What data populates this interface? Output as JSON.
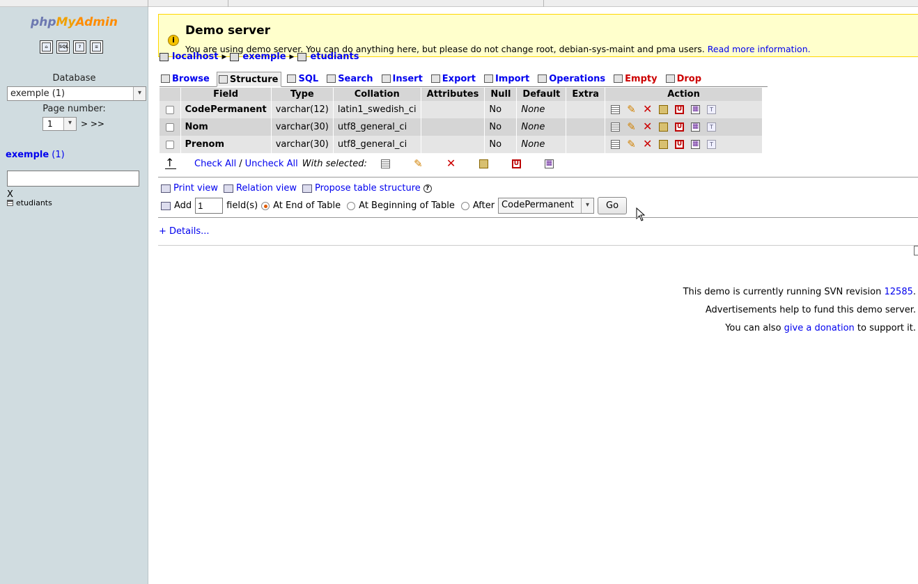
{
  "nav": {
    "logo": {
      "part1": "php",
      "part2": "My",
      "part3": "Admin"
    },
    "icons": [
      "home-icon",
      "sql-window-icon",
      "query-window-icon",
      "docs-icon"
    ],
    "database_label": "Database",
    "database_value": "exemple (1)",
    "page_number_label": "Page number:",
    "page_value": "1",
    "page_nav": "> >>",
    "db_link": "exemple",
    "db_count": "(1)",
    "filter_clear": "X",
    "tables": [
      "etudiants"
    ]
  },
  "notice": {
    "title": "Demo server",
    "text": "You are using demo server. You can do anything here, but please do not change root, debian-sys-maint and pma users.",
    "link": "Read more information."
  },
  "breadcrumb": {
    "server": "localhost",
    "database": "exemple",
    "table": "etudiants"
  },
  "tabs": [
    {
      "label": "Browse"
    },
    {
      "label": "Structure"
    },
    {
      "label": "SQL"
    },
    {
      "label": "Search"
    },
    {
      "label": "Insert"
    },
    {
      "label": "Export"
    },
    {
      "label": "Import"
    },
    {
      "label": "Operations"
    },
    {
      "label": "Empty"
    },
    {
      "label": "Drop"
    }
  ],
  "table": {
    "headers": [
      "Field",
      "Type",
      "Collation",
      "Attributes",
      "Null",
      "Default",
      "Extra",
      "Action"
    ],
    "rows": [
      {
        "field": "CodePermanent",
        "type": "varchar(12)",
        "collation": "latin1_swedish_ci",
        "attributes": "",
        "null": "No",
        "default": "None",
        "extra": ""
      },
      {
        "field": "Nom",
        "type": "varchar(30)",
        "collation": "utf8_general_ci",
        "attributes": "",
        "null": "No",
        "default": "None",
        "extra": ""
      },
      {
        "field": "Prenom",
        "type": "varchar(30)",
        "collation": "utf8_general_ci",
        "attributes": "",
        "null": "No",
        "default": "None",
        "extra": ""
      }
    ],
    "check_all": "Check All",
    "slash": "/",
    "uncheck_all": "Uncheck All",
    "with_selected": "With selected:"
  },
  "tools": {
    "print_view": "Print view",
    "relation_view": "Relation view",
    "propose": "Propose table structure"
  },
  "add_field": {
    "add_label": "Add",
    "count": "1",
    "fields_label": "field(s)",
    "at_end": "At End of Table",
    "at_beginning": "At Beginning of Table",
    "after_label": "After",
    "after_value": "CodePermanent",
    "go": "Go"
  },
  "details": "+ Details...",
  "footer": {
    "svn_text": "This demo is currently running SVN revision",
    "svn_rev": "12585",
    "svn_end": ".",
    "ads": "Advertisements help to fund this demo server.",
    "donate_pre": "You can also",
    "donate_link": "give a donation",
    "donate_post": "to support it."
  }
}
